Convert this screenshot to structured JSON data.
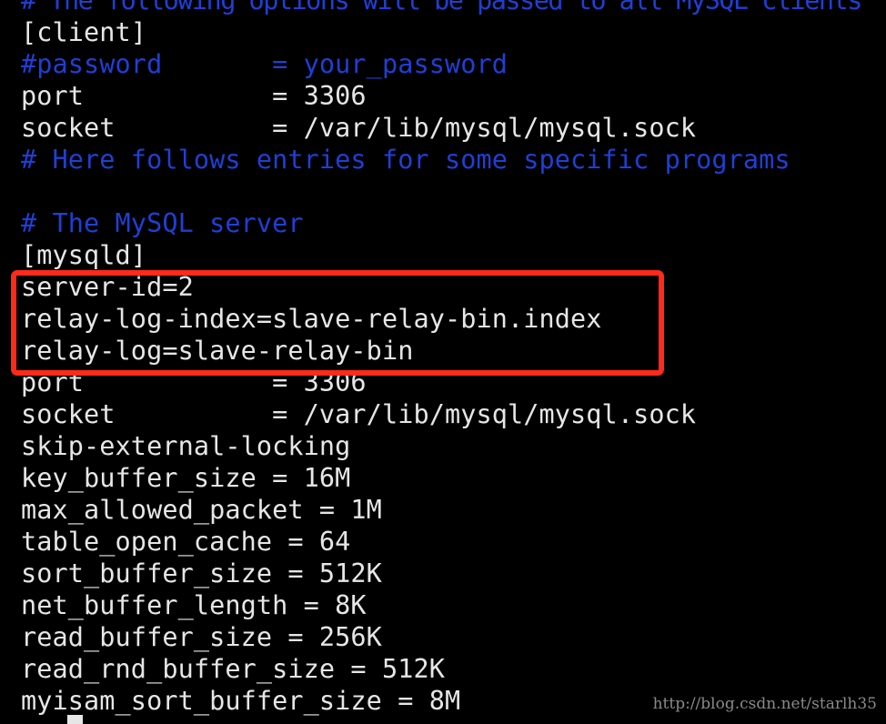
{
  "terminal": {
    "lines": [
      {
        "text": "# The following options will be passed to all MySQL clients",
        "type": "comment"
      },
      {
        "text": "[client]",
        "type": "text"
      },
      {
        "text": "#password       = your_password",
        "type": "comment"
      },
      {
        "text": "port            = 3306",
        "type": "text"
      },
      {
        "text": "socket          = /var/lib/mysql/mysql.sock",
        "type": "text"
      },
      {
        "text": "# Here follows entries for some specific programs",
        "type": "comment"
      },
      {
        "text": "",
        "type": "text"
      },
      {
        "text": "# The MySQL server",
        "type": "comment"
      },
      {
        "text": "[mysqld]",
        "type": "text"
      },
      {
        "text": "server-id=2",
        "type": "text"
      },
      {
        "text": "relay-log-index=slave-relay-bin.index",
        "type": "text"
      },
      {
        "text": "relay-log=slave-relay-bin",
        "type": "text"
      },
      {
        "text": "port            = 3306",
        "type": "text"
      },
      {
        "text": "socket          = /var/lib/mysql/mysql.sock",
        "type": "text"
      },
      {
        "text": "skip-external-locking",
        "type": "text"
      },
      {
        "text": "key_buffer_size = 16M",
        "type": "text"
      },
      {
        "text": "max_allowed_packet = 1M",
        "type": "text"
      },
      {
        "text": "table_open_cache = 64",
        "type": "text"
      },
      {
        "text": "sort_buffer_size = 512K",
        "type": "text"
      },
      {
        "text": "net_buffer_length = 8K",
        "type": "text"
      },
      {
        "text": "read_buffer_size = 256K",
        "type": "text"
      },
      {
        "text": "read_rnd_buffer_size = 512K",
        "type": "text"
      },
      {
        "text": "myisam_sort_buffer_size = 8M",
        "type": "text"
      }
    ],
    "colors": {
      "background": "#000000",
      "text": "#e6e6e6",
      "comment": "#1f3fd6",
      "highlight": "#ff2a1a"
    }
  },
  "watermark": "http://blog.csdn.net/starlh35"
}
